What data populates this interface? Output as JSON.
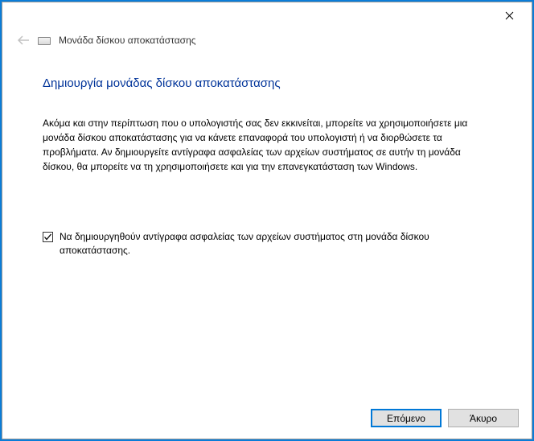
{
  "titlebar": {
    "wizard_name": "Μονάδα δίσκου αποκατάστασης"
  },
  "page": {
    "heading": "Δημιουργία μονάδας δίσκου αποκατάστασης",
    "description": "Ακόμα και στην περίπτωση που ο υπολογιστής σας δεν εκκινείται, μπορείτε να χρησιμοποιήσετε μια μονάδα δίσκου αποκατάστασης για να κάνετε επαναφορά του υπολογιστή ή να διορθώσετε τα προβλήματα. Αν δημιουργείτε αντίγραφα ασφαλείας των αρχείων συστήματος σε αυτήν τη μονάδα δίσκου, θα μπορείτε να τη χρησιμοποιήσετε και για την επανεγκατάσταση των Windows.",
    "checkbox": {
      "checked": true,
      "label": "Να δημιουργηθούν αντίγραφα ασφαλείας των αρχείων συστήματος στη μονάδα δίσκου αποκατάστασης."
    }
  },
  "footer": {
    "next": "Επόμενο",
    "cancel": "Άκυρο"
  }
}
